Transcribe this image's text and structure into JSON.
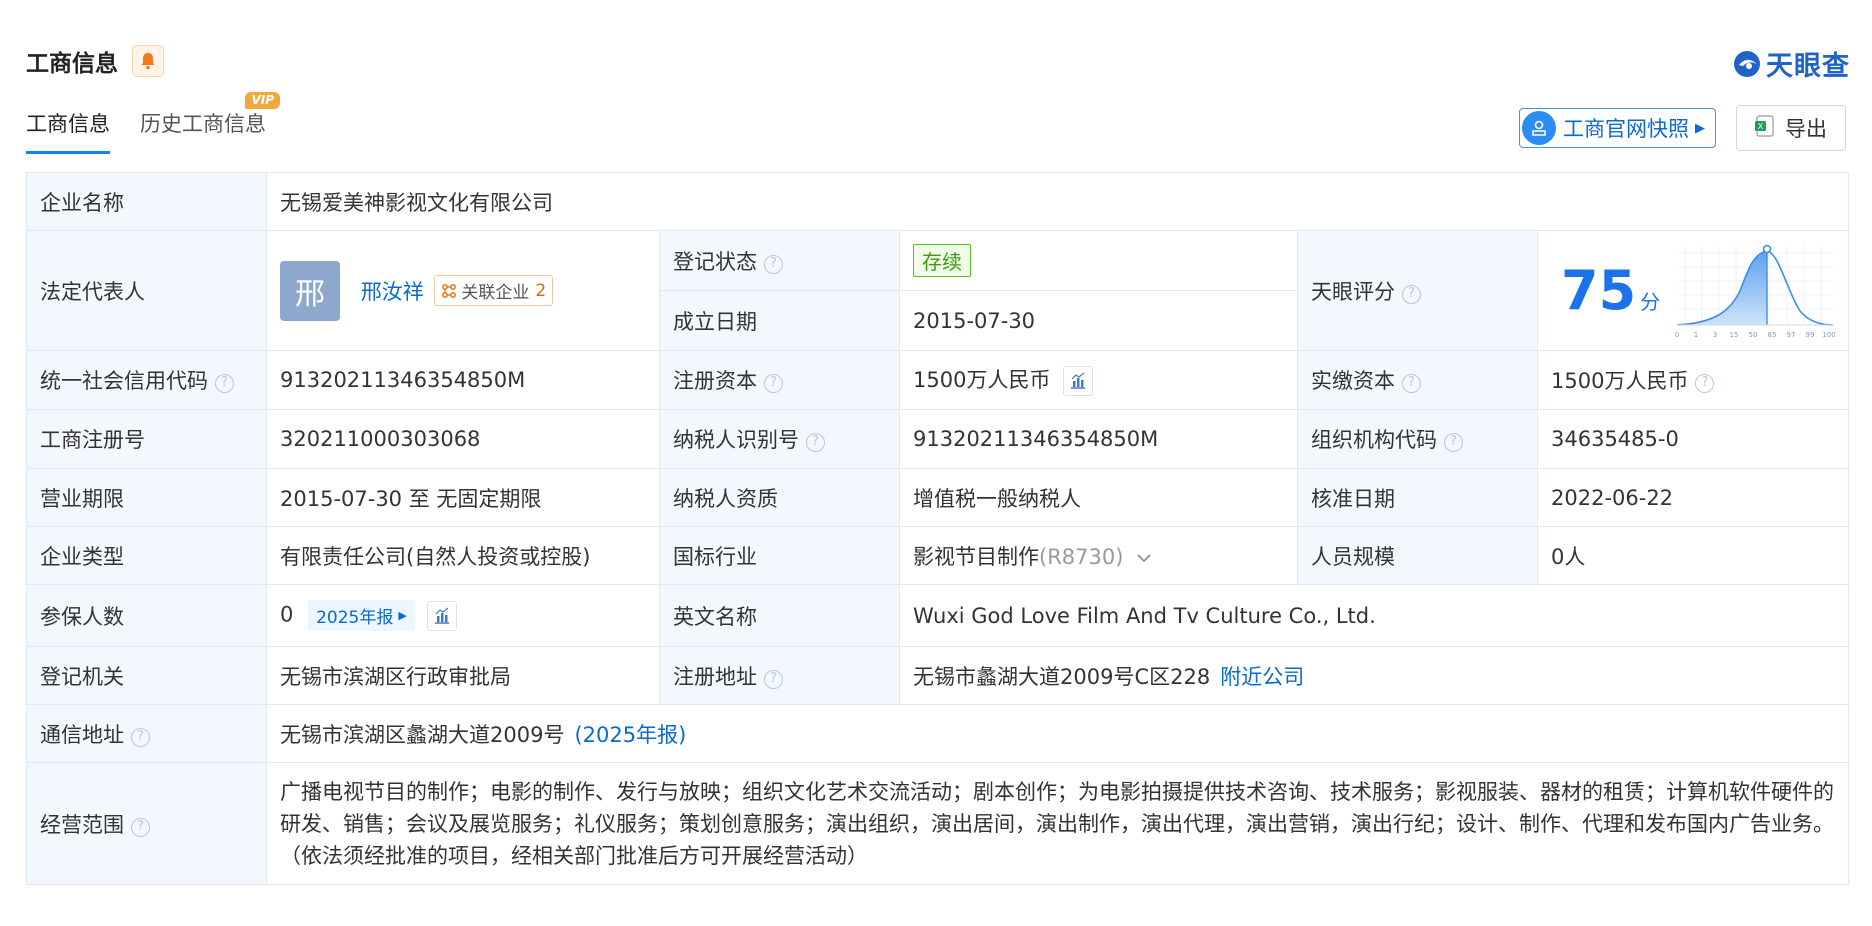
{
  "header": {
    "title": "工商信息",
    "brand": "天眼查"
  },
  "tabs": [
    {
      "label": "工商信息"
    },
    {
      "label": "历史工商信息",
      "badge": "VIP"
    }
  ],
  "actions": {
    "snapshot": "工商官网快照",
    "export": "导出"
  },
  "labels": {
    "company_name": "企业名称",
    "legal_rep": "法定代表人",
    "reg_status": "登记状态",
    "found_date": "成立日期",
    "tianyan_score": "天眼评分",
    "credit_code": "统一社会信用代码",
    "reg_capital": "注册资本",
    "paid_capital": "实缴资本",
    "reg_no": "工商注册号",
    "taxpayer_id": "纳税人识别号",
    "org_code": "组织机构代码",
    "biz_term": "营业期限",
    "taxpayer_qual": "纳税人资质",
    "approve_date": "核准日期",
    "company_type": "企业类型",
    "industry": "国标行业",
    "staff_size": "人员规模",
    "insured": "参保人数",
    "english_name": "英文名称",
    "reg_authority": "登记机关",
    "reg_address": "注册地址",
    "mail_address": "通信地址",
    "biz_scope": "经营范围"
  },
  "values": {
    "company_name": "无锡爱美神影视文化有限公司",
    "legal_rep_avatar": "邢",
    "legal_rep_name": "邢汝祥",
    "related_label": "关联企业",
    "related_count": "2",
    "reg_status": "存续",
    "found_date": "2015-07-30",
    "score": "75",
    "score_unit": "分",
    "credit_code": "91320211346354850M",
    "reg_capital": "1500万人民币",
    "paid_capital": "1500万人民币",
    "reg_no": "320211000303068",
    "taxpayer_id": "91320211346354850M",
    "org_code": "34635485-0",
    "biz_term": "2015-07-30 至 无固定期限",
    "taxpayer_qual": "增值税一般纳税人",
    "approve_date": "2022-06-22",
    "company_type": "有限责任公司(自然人投资或控股)",
    "industry": "影视节目制作",
    "industry_code": "(R8730)",
    "staff_size": "0人",
    "insured": "0",
    "insured_report": "2025年报",
    "english_name": "Wuxi God Love Film And Tv Culture Co., Ltd.",
    "reg_authority": "无锡市滨湖区行政审批局",
    "reg_address": "无锡市蠡湖大道2009号C区228",
    "nearby_link": "附近公司",
    "mail_address": "无锡市滨湖区蠡湖大道2009号",
    "mail_report": "(2025年报)",
    "biz_scope": "广播电视节目的制作；电影的制作、发行与放映；组织文化艺术交流活动；剧本创作；为电影拍摄提供技术咨询、技术服务；影视服装、器材的租赁；计算机软件硬件的研发、销售；会议及展览服务；礼仪服务；策划创意服务；演出组织，演出居间，演出制作，演出代理，演出营销，演出行纪；设计、制作、代理和发布国内广告业务。（依法须经批准的项目，经相关部门批准后方可开展经营活动）"
  },
  "score_chart": {
    "x_ticks": [
      "0",
      "1",
      "3",
      "15",
      "50",
      "85",
      "97",
      "99",
      "100"
    ]
  },
  "colors": {
    "accent": "#0a84ff",
    "link": "#0a6ad0",
    "label_bg": "#f2f8fe",
    "status_green": "#52c41a",
    "score_blue": "#1a73e8"
  }
}
